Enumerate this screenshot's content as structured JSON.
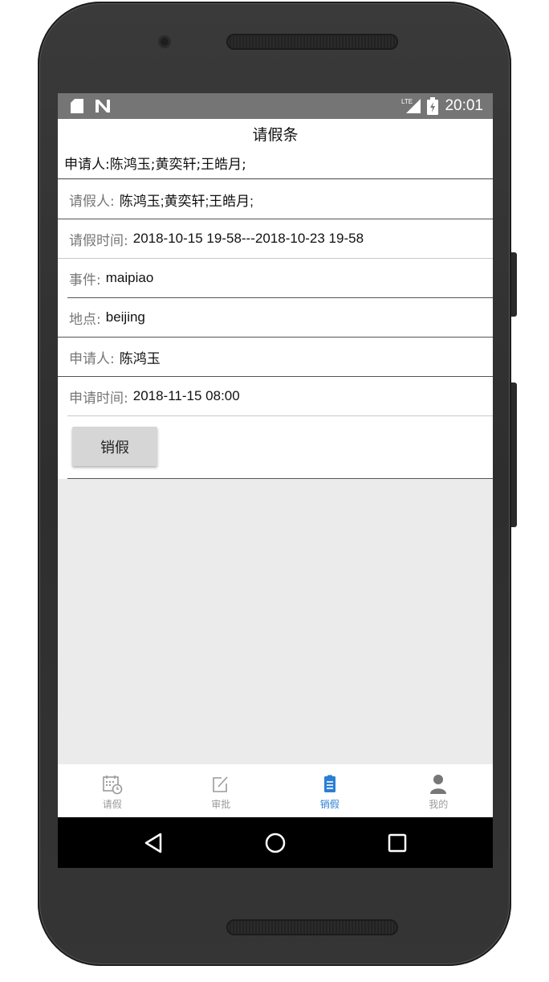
{
  "status_bar": {
    "time": "20:01",
    "network": "LTE",
    "icons": [
      "sd-card-icon",
      "n-notification-icon",
      "lte-signal-icon",
      "battery-charging-icon"
    ]
  },
  "header": {
    "title": "请假条"
  },
  "summary": {
    "applicants_text": "申请人:陈鸿玉;黄奕轩;王皓月;"
  },
  "details": {
    "leave_person_label": "请假人:",
    "leave_person_value": "陈鸿玉;黄奕轩;王皓月;",
    "leave_time_label": "请假时间:",
    "leave_time_value": "2018-10-15 19-58---2018-10-23 19-58",
    "event_label": "事件:",
    "event_value": "maipiao",
    "location_label": "地点:",
    "location_value": "beijing",
    "applicant_label": "申请人:",
    "applicant_value": "陈鸿玉",
    "apply_time_label": "申请时间:",
    "apply_time_value": "2018-11-15 08:00"
  },
  "actions": {
    "cancel_leave_label": "销假"
  },
  "tabs": [
    {
      "label": "请假",
      "icon": "calendar-clock-icon",
      "active": false
    },
    {
      "label": "审批",
      "icon": "edit-icon",
      "active": false
    },
    {
      "label": "销假",
      "icon": "clipboard-icon",
      "active": true
    },
    {
      "label": "我的",
      "icon": "person-icon",
      "active": false
    }
  ],
  "colors": {
    "accent": "#2a7fd4",
    "inactive_tab": "#9a9a9a",
    "status_bar": "#757575",
    "content_bg": "#ebebeb"
  }
}
